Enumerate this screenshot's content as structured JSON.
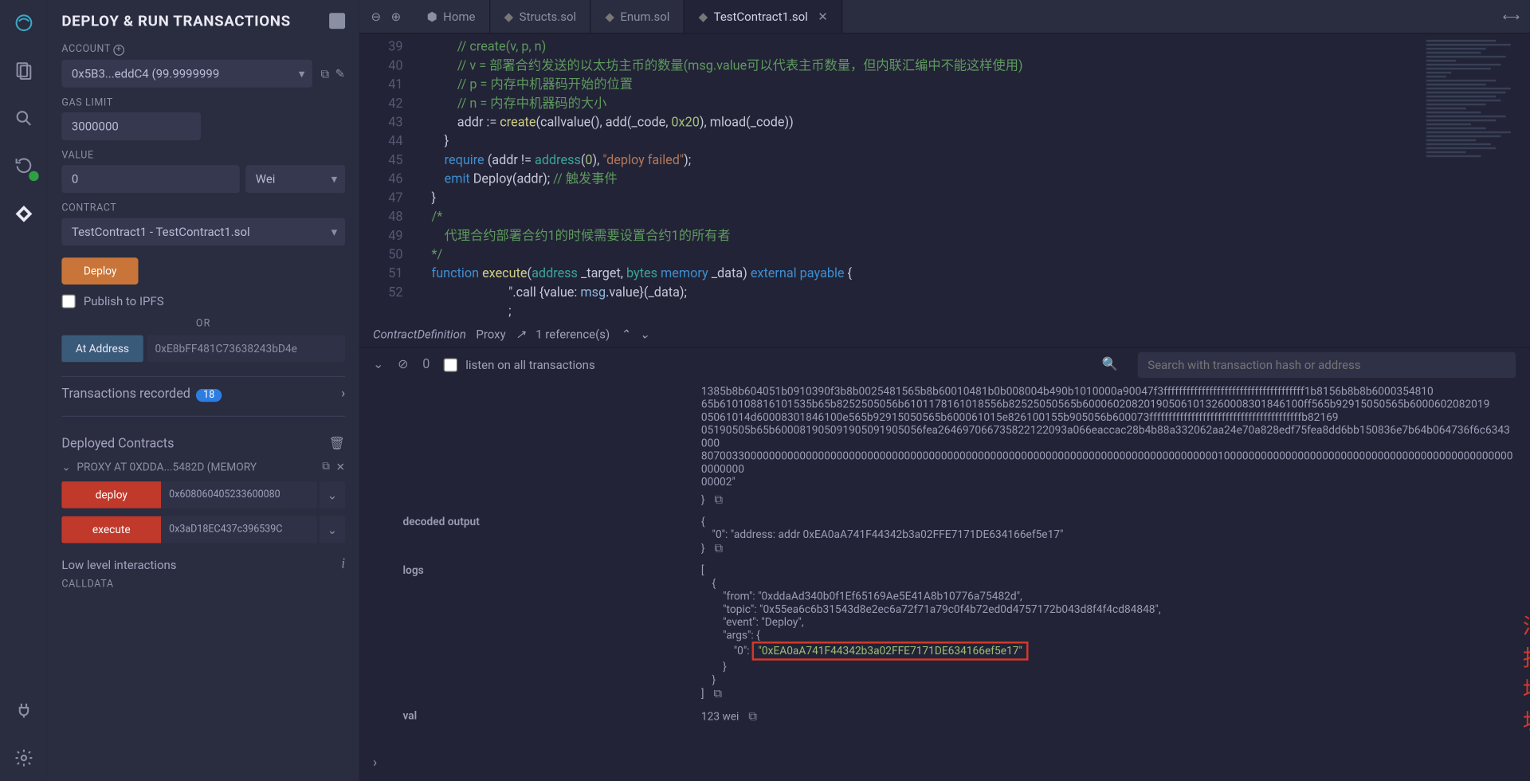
{
  "panel": {
    "title": "DEPLOY & RUN TRANSACTIONS",
    "account_label": "ACCOUNT",
    "account_value": "0x5B3...eddC4 (99.9999999",
    "gaslimit_label": "GAS LIMIT",
    "gaslimit_value": "3000000",
    "value_label": "VALUE",
    "value_amount": "0",
    "value_unit": "Wei",
    "contract_label": "CONTRACT",
    "contract_value": "TestContract1 - TestContract1.sol",
    "deploy_btn": "Deploy",
    "publish_ipfs": "Publish to IPFS",
    "or": "OR",
    "at_address_btn": "At Address",
    "at_address_value": "0xE8bFF481C73638243bD4e",
    "tx_recorded": "Transactions recorded",
    "tx_badge": "18",
    "deployed_title": "Deployed Contracts",
    "contract_name": "PROXY AT 0XDDA...5482D (MEMORY",
    "fn1": {
      "name": "deploy",
      "arg": "0x608060405233600080"
    },
    "fn2": {
      "name": "execute",
      "arg": "0x3aD18EC437c396539C"
    },
    "low_level": "Low level interactions",
    "calldata_label": "CALLDATA"
  },
  "tabs": {
    "home": "Home",
    "t1": "Structs.sol",
    "t2": "Enum.sol",
    "t3": "TestContract1.sol"
  },
  "editor": {
    "lines": {
      "39": "            // create(v, p, n)",
      "40": "            // v = 部署合约发送的以太坊主币的数量(msg.value可以代表主币数量，但内联汇编中不能这样使用)",
      "41": "            // p = 内存中机器码开始的位置",
      "42": "            // n = 内存中机器码的大小",
      "43a": "            addr := ",
      "43b": "create",
      "43c": "(callvalue(), add(_code, ",
      "43d": "0x20",
      "43e": "), mload(_code))",
      "44": "        }",
      "45a": "        require",
      "45b": " (addr != ",
      "45c": "address",
      "45d": "(",
      "45e": "0",
      "45f": "), ",
      "45g": "\"deploy failed\"",
      "45h": ");",
      "46a": "        emit",
      "46b": " Deploy(addr); ",
      "46c": "// 触发事件",
      "47": "    }",
      "48": "",
      "49": "    /*",
      "50": "        代理合约部署合约1的时候需要设置合约1的所有者",
      "51": "    */",
      "52a": "    function",
      "52b": " execute",
      "52c": "(",
      "52d": "address",
      "52e": " _target, ",
      "52f": "bytes",
      "52g": " memory",
      "52h": " _data) ",
      "52i": "external",
      "52j": " payable",
      "52k": " {",
      "53a": "                            \".call {value: ",
      "53b": "msg",
      "53c": ".value}(_data);",
      "54": "                            ;"
    },
    "gutter": [
      "39",
      "40",
      "41",
      "42",
      "43",
      "44",
      "45",
      "46",
      "47",
      "48",
      "49",
      "50",
      "51",
      "52",
      "",
      ""
    ]
  },
  "bread": {
    "def": "ContractDefinition",
    "name": "Proxy",
    "refs": "1 reference(s)"
  },
  "terminal": {
    "count": "0",
    "listen": "listen on all transactions",
    "search_ph": "Search with transaction hash or address"
  },
  "output": {
    "input_blob": "1385b8b604051b0910390f3b8b0025481565b8b60010481b0b008004b490b1010000a90047f3fffffffffffffffffffffffffffffffffffff1b8156b8b8b6000354810\n65b610108816101535b65b8252505056b6101178161018556b82525050565b600060208201905061013260008301846100ff565b92915050565b6000602082019\n05061014d60008301846100e565b92915050565b600061015e826100155b905056b600073ffffffffffffffffffffffffffffffffffffffffb82169\n05190505b65b600081905091905091905056fea264697066735822122093a066eaccac28b4b88a332062aa24e70a828edf75fea8dd6bb150836e7b64b064736f6c6343000\n8070033000000000000000000000000000000000000000000000000000000000000000000000000000001000000000000000000000000000000000000000000000000000000\n00002\"",
    "decoded_key": "decoded output",
    "decoded_val": "{\n    \"0\": \"address: addr 0xEA0aA741F44342b3a02FFE7171DE634166ef5e17\"\n}",
    "logs_key": "logs",
    "logs": {
      "from": "\"0xddaAd340b0f1Ef65169Ae5E41A8b10776a75482d\"",
      "topic": "\"0x55ea6c6b31543d8e2ec6a72f71a79c0f4b72ed0d4757172b043d8f4f4cd84848\"",
      "event": "\"Deploy\"",
      "args_0": "0xEA0aA741F44342b3a02FFE7171DE634166ef5e17"
    },
    "val_key": "val",
    "val_val": "123 wei"
  },
  "annotation": "汇报地址"
}
